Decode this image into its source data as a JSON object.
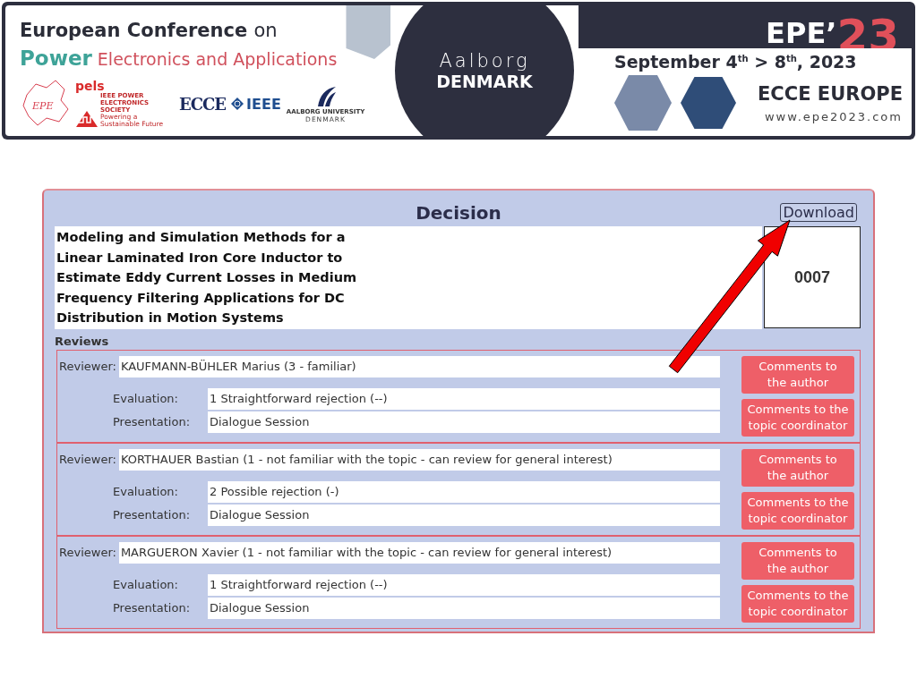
{
  "banner": {
    "heading_1": "European Conference",
    "heading_1_tail": "on",
    "heading_2_accent": "Power",
    "heading_2_tail": "Electronics and Applications",
    "logos": {
      "epe": "EPE",
      "pels": "pels",
      "pels_society": "IEEE POWER ELECTRONICS SOCIETY",
      "pels_tagline": "Powering a Sustainable Future",
      "ecce": "ECCE",
      "ieee": "IEEE",
      "university": "AALBORG UNIVERSITY",
      "university_country": "DENMARK"
    },
    "city": "Aalborg",
    "country": "DENMARK",
    "event": "EPE",
    "event_mark": "’",
    "event_year": "23",
    "dates": "September 4$^{th}$ > 8$^{th}$, 2023",
    "subtitle": "ECCE EUROPE",
    "url": "www.epe2023.com"
  },
  "panel": {
    "title": "Decision",
    "download": "Download",
    "paper_title": "Modeling and Simulation Methods for a Linear Laminated Iron Core Inductor to Estimate Eddy Current Losses in Medium Frequency Filtering Applications for DC Distribution in Motion Systems",
    "paper_id": "0007",
    "reviews_label": "Reviews",
    "reviews": [
      {
        "reviewer_label": "Reviewer:",
        "reviewer": "KAUFMANN-BÜHLER Marius (3 - familiar)",
        "evaluation_label": "Evaluation:",
        "evaluation": "1 Straightforward rejection (--)",
        "presentation_label": "Presentation:",
        "presentation": "Dialogue Session",
        "buttons": [
          "Comments to the author",
          "Comments to the topic coordinator"
        ]
      },
      {
        "reviewer_label": "Reviewer:",
        "reviewer": "KORTHAUER Bastian (1 - not familiar with the topic - can review for general interest)",
        "evaluation_label": "Evaluation:",
        "evaluation": "2 Possible rejection (-)",
        "presentation_label": "Presentation:",
        "presentation": "Dialogue Session",
        "buttons": [
          "Comments to the author",
          "Comments to the topic coordinator"
        ]
      },
      {
        "reviewer_label": "Reviewer:",
        "reviewer": "MARGUERON Xavier (1 - not familiar with the topic - can review for general interest)",
        "evaluation_label": "Evaluation:",
        "evaluation": "1 Straightforward rejection (--)",
        "presentation_label": "Presentation:",
        "presentation": "Dialogue Session",
        "buttons": [
          "Comments to the author",
          "Comments to the topic coordinator"
        ]
      }
    ]
  },
  "annotation": {
    "kind": "arrow"
  }
}
